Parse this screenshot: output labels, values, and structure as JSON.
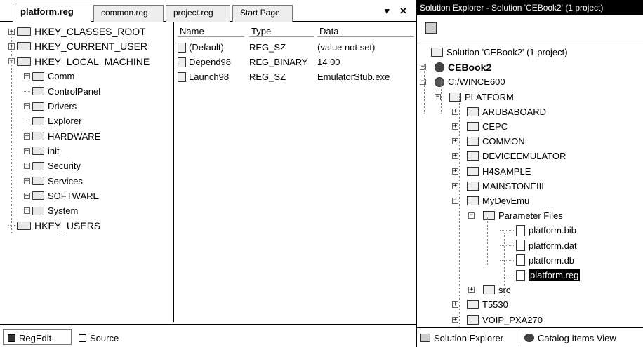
{
  "editor": {
    "tabs": [
      {
        "label": "platform.reg",
        "active": true
      },
      {
        "label": "common.reg",
        "active": false
      },
      {
        "label": "project.reg",
        "active": false
      },
      {
        "label": "Start Page",
        "active": false
      }
    ],
    "dropdown_glyph": "▾",
    "close_glyph": "✕",
    "tree": [
      {
        "label": "HKEY_CLASSES_ROOT",
        "expander": "+",
        "level": 0
      },
      {
        "label": "HKEY_CURRENT_USER",
        "expander": "+",
        "level": 0
      },
      {
        "label": "HKEY_LOCAL_MACHINE",
        "expander": "−",
        "level": 0
      },
      {
        "label": "Comm",
        "expander": "+",
        "level": 1
      },
      {
        "label": "ControlPanel",
        "expander": "",
        "level": 1
      },
      {
        "label": "Drivers",
        "expander": "+",
        "level": 1
      },
      {
        "label": "Explorer",
        "expander": "",
        "level": 1
      },
      {
        "label": "HARDWARE",
        "expander": "+",
        "level": 1
      },
      {
        "label": "init",
        "expander": "+",
        "level": 1
      },
      {
        "label": "Security",
        "expander": "+",
        "level": 1
      },
      {
        "label": "Services",
        "expander": "+",
        "level": 1
      },
      {
        "label": "SOFTWARE",
        "expander": "+",
        "level": 1
      },
      {
        "label": "System",
        "expander": "+",
        "level": 1
      },
      {
        "label": "HKEY_USERS",
        "expander": "",
        "level": 0
      }
    ],
    "list": {
      "columns": [
        "Name",
        "Type",
        "Data"
      ],
      "rows": [
        [
          "(Default)",
          "REG_SZ",
          "(value not set)"
        ],
        [
          "Depend98",
          "REG_BINARY",
          "14 00"
        ],
        [
          "Launch98",
          "REG_SZ",
          "EmulatorStub.exe"
        ]
      ]
    },
    "bottom_tabs": [
      {
        "label": "RegEdit"
      },
      {
        "label": "Source"
      }
    ]
  },
  "solution_explorer": {
    "title": "Solution Explorer - Solution 'CEBook2' (1 project)",
    "tree": [
      {
        "label": "Solution 'CEBook2' (1 project)",
        "level": 0,
        "expander": "",
        "kind": "solution",
        "bold": false
      },
      {
        "label": "CEBook2",
        "level": 0,
        "expander": "−",
        "kind": "project",
        "bold": true
      },
      {
        "label": "C:/WINCE600",
        "level": 1,
        "expander": "−",
        "kind": "platform",
        "bold": false
      },
      {
        "label": "PLATFORM",
        "level": 2,
        "expander": "−",
        "kind": "folder",
        "bold": false
      },
      {
        "label": "ARUBABOARD",
        "level": 3,
        "expander": "+",
        "kind": "folder",
        "bold": false
      },
      {
        "label": "CEPC",
        "level": 3,
        "expander": "+",
        "kind": "folder",
        "bold": false
      },
      {
        "label": "COMMON",
        "level": 3,
        "expander": "+",
        "kind": "folder",
        "bold": false
      },
      {
        "label": "DEVICEEMULATOR",
        "level": 3,
        "expander": "+",
        "kind": "folder",
        "bold": false
      },
      {
        "label": "H4SAMPLE",
        "level": 3,
        "expander": "+",
        "kind": "folder",
        "bold": false
      },
      {
        "label": "MAINSTONEIII",
        "level": 3,
        "expander": "+",
        "kind": "folder",
        "bold": false
      },
      {
        "label": "MyDevEmu",
        "level": 3,
        "expander": "−",
        "kind": "folder",
        "bold": false
      },
      {
        "label": "Parameter Files",
        "level": 4,
        "expander": "−",
        "kind": "folder",
        "bold": false
      },
      {
        "label": "platform.bib",
        "level": 5,
        "expander": "",
        "kind": "file",
        "bold": false
      },
      {
        "label": "platform.dat",
        "level": 5,
        "expander": "",
        "kind": "file",
        "bold": false
      },
      {
        "label": "platform.db",
        "level": 5,
        "expander": "",
        "kind": "file",
        "bold": false
      },
      {
        "label": "platform.reg",
        "level": 5,
        "expander": "",
        "kind": "file",
        "bold": false,
        "selected": true
      },
      {
        "label": "src",
        "level": 4,
        "expander": "+",
        "kind": "folder",
        "bold": false
      },
      {
        "label": "T5530",
        "level": 3,
        "expander": "+",
        "kind": "folder",
        "bold": false
      },
      {
        "label": "VOIP_PXA270",
        "level": 3,
        "expander": "+",
        "kind": "folder",
        "bold": false
      }
    ],
    "bottom_tabs": [
      {
        "label": "Solution Explorer"
      },
      {
        "label": "Catalog Items View"
      }
    ]
  }
}
